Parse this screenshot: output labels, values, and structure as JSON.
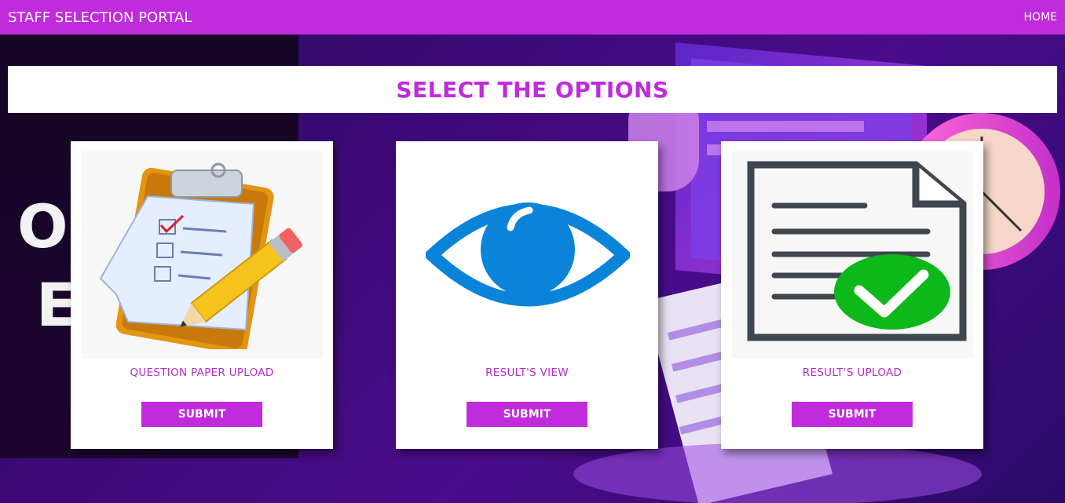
{
  "header": {
    "brand": "STAFF SELECTION PORTAL",
    "home_link": "HOME"
  },
  "banner": {
    "title": "SELECT THE OPTIONS"
  },
  "background": {
    "word_line1": "O",
    "word_line2": "E"
  },
  "cards": [
    {
      "label": "QUESTION PAPER UPLOAD",
      "button": "SUBMIT",
      "icon": "clipboard-pencil-icon"
    },
    {
      "label": "RESULT'S VIEW",
      "button": "SUBMIT",
      "icon": "eye-icon"
    },
    {
      "label": "RESULT'S UPLOAD",
      "button": "SUBMIT",
      "icon": "document-check-icon"
    }
  ],
  "colors": {
    "accent": "#c02bdc",
    "label": "#b22fc9",
    "eye_blue": "#0a84d8",
    "check_green": "#0cb81a",
    "doc_grey": "#3e4650"
  }
}
